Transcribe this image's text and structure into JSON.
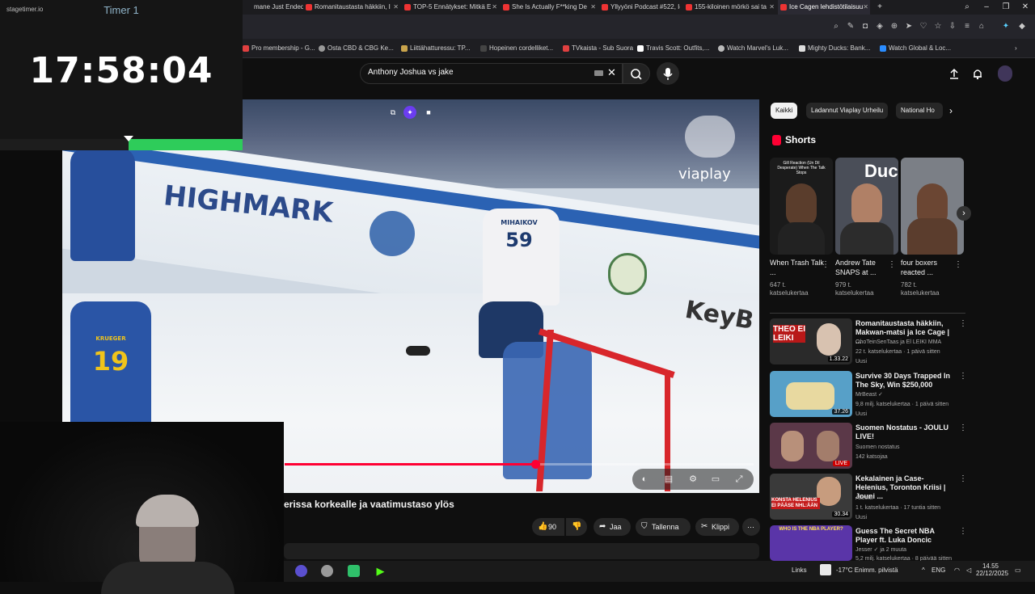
{
  "stagetimer": {
    "logo": "stagetimer.io",
    "title": "Timer 1",
    "time": "17:58:04",
    "progress_fraction": 0.47
  },
  "browser": {
    "tabs": [
      {
        "label": "mane Just Ended t"
      },
      {
        "label": "Romanitaustasta häkkiin, I"
      },
      {
        "label": "TOP-5 Ennätykset: Mitkä E"
      },
      {
        "label": "She Is Actually F**king De"
      },
      {
        "label": "Yllyyöni Podcast #522, Ice"
      },
      {
        "label": "155-kiloinen mörkö sai ta"
      },
      {
        "label": "Ice Cagen lehdistötilaisuu"
      }
    ],
    "bookmarks": [
      {
        "label": "Pro membership - G..."
      },
      {
        "label": "Osta CBD & CBG Ke..."
      },
      {
        "label": "Liittähatturessu: TP..."
      },
      {
        "label": "Hopeinen cordelliket..."
      },
      {
        "label": "TVkaista - Sub Suora"
      },
      {
        "label": "Travis Scott: Outfits,..."
      },
      {
        "label": "Watch Marvel's Luk..."
      },
      {
        "label": "Mighty Ducks: Bank..."
      },
      {
        "label": "Watch Global & Loc..."
      }
    ]
  },
  "youtube": {
    "search": {
      "value": "Anthony Joshua vs jake"
    },
    "video": {
      "watermark": "viaplay",
      "ad_text_1": "HIGHMARK",
      "ad_text_2": "KeyB",
      "player_number_1": "59",
      "player_name_1": "MIHAIKOV",
      "player_number_2": "19",
      "player_name_2": "KRUEGER",
      "progress_fraction": 0.535
    },
    "title": "erissa korkealle ja vaatimustaso ylös",
    "actions": {
      "likes": "90",
      "share": "Jaa",
      "save": "Tallenna",
      "clip": "Klippi"
    },
    "chips": [
      {
        "label": "Kaikki"
      },
      {
        "label": "Ladannut Viaplay Urheilu"
      },
      {
        "label": "National Ho"
      }
    ],
    "shorts": {
      "label": "Shorts",
      "items": [
        {
          "title": "When Trash Talk ...",
          "views": "647 t. katselukertaa",
          "overlay": "Gill Reaction (Un Dil Desperate) When The Talk Stops"
        },
        {
          "title": "Andrew Tate SNAPS at ...",
          "views": "979 t. katselukertaa",
          "overlay": "Duc"
        },
        {
          "title": "four boxers reacted ...",
          "views": "782 t. katselukertaa",
          "overlay": ""
        }
      ]
    },
    "recommendations": [
      {
        "title": "Romanitaustasta häkkiin, Makwan-matsi ja Ice Cage | ...",
        "channel": "OhoTeinSenTaas ja El LEIKI MMA",
        "meta": "22 t. katselukertaa · 1 päivä sitten",
        "badge": "Uusi",
        "duration": "1.33.22",
        "thumb_text": "THEO EI LEIKI"
      },
      {
        "title": "Survive 30 Days Trapped In The Sky, Win $250,000",
        "channel": "MrBeast ✓",
        "meta": "9,8 milj. katselukertaa · 1 päivä sitten",
        "badge": "Uusi",
        "duration": "37.26",
        "thumb_text": ""
      },
      {
        "title": "Suomen Nostatus - JOULU LIVE!",
        "channel": "Suomen nostatus",
        "meta": "142 katsojaa",
        "badge": "",
        "duration": "LIVE",
        "thumb_text": ""
      },
      {
        "title": "Kekalainen ja Case-Helenius, Toronton Kriisi | Jouni ...",
        "channel": "Alleetti",
        "meta": "1 t. katselukertaa · 17 tuntia sitten",
        "badge": "Uusi",
        "duration": "30.34",
        "thumb_text": "KONSTA HELENIUS EI PÄÄSE NHL:ÄÄN"
      },
      {
        "title": "Guess The Secret NBA Player ft. Luka Doncic",
        "channel": "Jesser ✓ ja 2 muuta",
        "meta": "5,2 milj. katselukertaa · 8 päivää sitten",
        "badge": "",
        "duration": "",
        "thumb_text": "WHO IS THE NBA PLAYER?"
      }
    ]
  },
  "taskbar": {
    "links": "Links",
    "weather": "-17°C  Enimm. pilvistä",
    "lang": "ENG",
    "time": "14.55",
    "date": "22/12/2025"
  },
  "colors": {
    "yt_red": "#ff0033",
    "timer_green": "#2ecc5a",
    "timer_title": "#8fb3c8"
  }
}
